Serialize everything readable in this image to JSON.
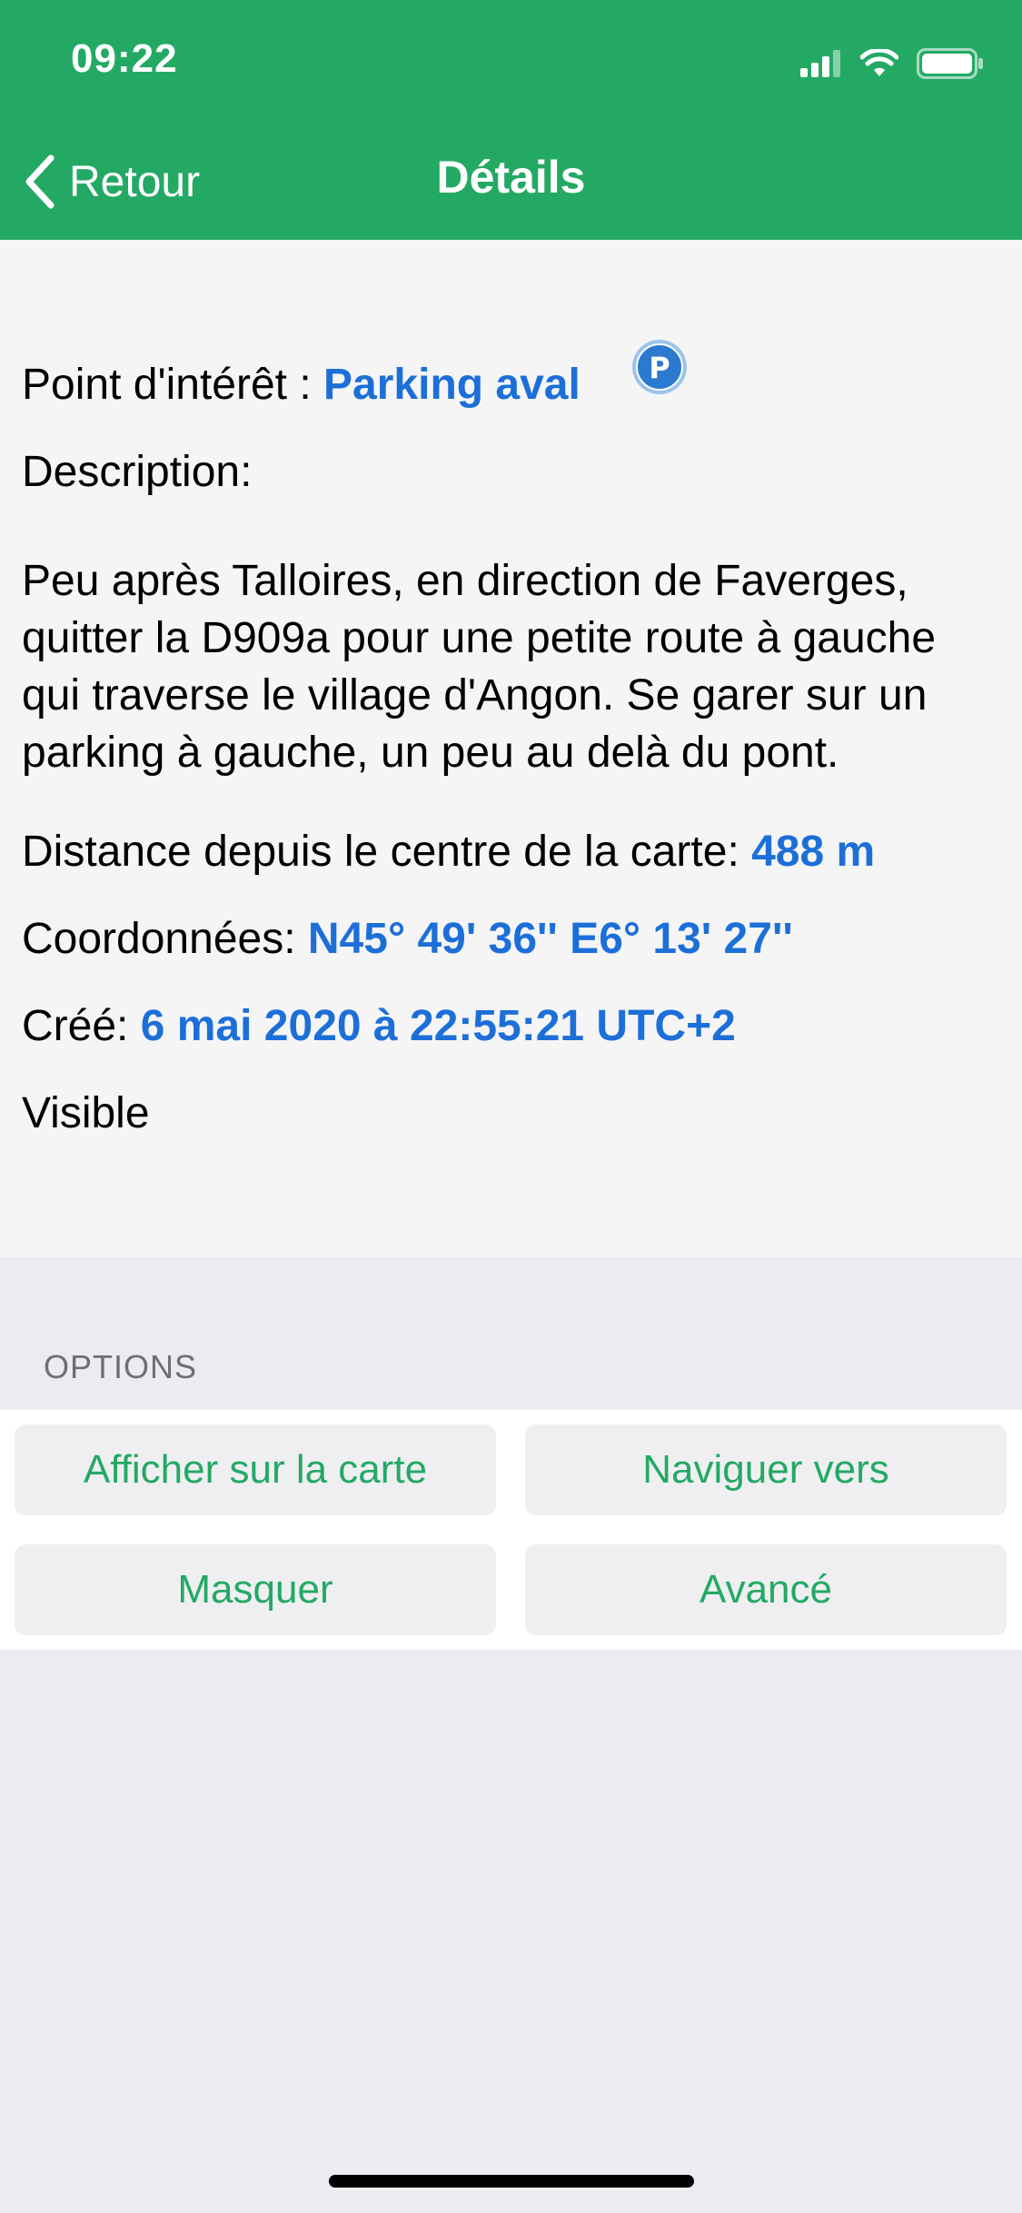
{
  "status_bar": {
    "time": "09:22"
  },
  "nav": {
    "back_label": "Retour",
    "title": "Détails"
  },
  "colors": {
    "header": "#24A965",
    "accent_link": "#1D6FD8",
    "button_text": "#24A965"
  },
  "details": {
    "poi_label": "Point d'intérêt : ",
    "poi_name": "Parking aval",
    "poi_icon_letter": "P",
    "description_label": "Description:",
    "description_text": "Peu après Talloires, en direction de Faverges, quitter la D909a pour une petite route à gauche qui traverse le village d'Angon. Se garer sur un parking à gauche, un peu au delà du pont.",
    "distance_label": "Distance depuis le centre de la carte: ",
    "distance_value": "488 m",
    "coords_label": "Coordonnées: ",
    "coords_value": "N45° 49' 36'' E6° 13' 27''",
    "created_label": "Créé: ",
    "created_value": "6 mai 2020 à 22:55:21 UTC+2",
    "visibility": "Visible"
  },
  "options": {
    "header": "OPTIONS",
    "show_on_map": "Afficher sur la carte",
    "navigate_to": "Naviguer vers",
    "hide": "Masquer",
    "advanced": "Avancé"
  }
}
